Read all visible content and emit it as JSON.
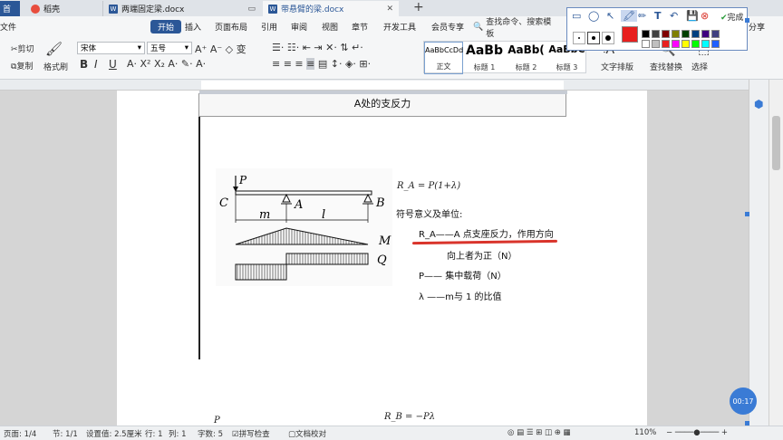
{
  "tabs": {
    "home": "首",
    "t1": "稻壳",
    "t2": "两端固定梁.docx",
    "t3": "带悬臂的梁.docx",
    "new_tab": "+"
  },
  "menu": {
    "file": "文件",
    "start": "开始",
    "insert": "插入",
    "page_layout": "页面布局",
    "references": "引用",
    "review": "审阅",
    "view": "视图",
    "chapter": "章节",
    "dev_tools": "开发工具",
    "member": "会员专享",
    "search": "查找命令、搜索模板",
    "share": "分享"
  },
  "toolbar": {
    "cut": "剪切",
    "copy": "复制",
    "format_painter": "格式刷",
    "font_name": "宋体",
    "font_size": "五号",
    "bold": "B",
    "italic": "I",
    "underline": "U",
    "text_layout": "文字排版",
    "find_replace": "查找替换",
    "select": "选择"
  },
  "styles": [
    {
      "sample": "AaBbCcDd",
      "label": "正文"
    },
    {
      "sample": "AaBb",
      "label": "标题 1"
    },
    {
      "sample": "AaBb(",
      "label": "标题 2"
    },
    {
      "sample": "AaBbC",
      "label": "标题 3"
    }
  ],
  "palette": {
    "done": "完成",
    "accent": "#e8201f",
    "colors": [
      "#000000",
      "#3f3f3f",
      "#7f0000",
      "#7f7f00",
      "#003f00",
      "#003f7f",
      "#3f007f",
      "#3f3f7f",
      "#ffffff",
      "#bfbfbf",
      "#e8201f",
      "#ff00ff",
      "#ffff00",
      "#00ff00",
      "#00ffff",
      "#2060ff"
    ]
  },
  "document": {
    "heading": "A处的支反力",
    "formula_ra": "R_A = P(1+λ)",
    "symbol_title": "符号意义及单位:",
    "line1": "R_A——A 点支座反力，作用方向",
    "line1b": "向上者为正（N）",
    "line2": "P—— 集中载荷（N）",
    "line3": "λ ——m与 1 的比值",
    "bottom_formula": "R_B = −Pλ",
    "bottom_left": "P",
    "diagram": {
      "P": "P",
      "C": "C",
      "A": "A",
      "B": "B",
      "m": "m",
      "l": "l",
      "M": "M",
      "Q": "Q"
    }
  },
  "timer": "00:17",
  "status": {
    "page": "页面: 1/4",
    "section": "节: 1/1",
    "setting": "设置值: 2.5厘米",
    "row": "行: 1",
    "col": "列: 1",
    "chars": "字数: 5",
    "spell": "拼写检查",
    "compare": "文档校对",
    "zoom": "110%"
  }
}
